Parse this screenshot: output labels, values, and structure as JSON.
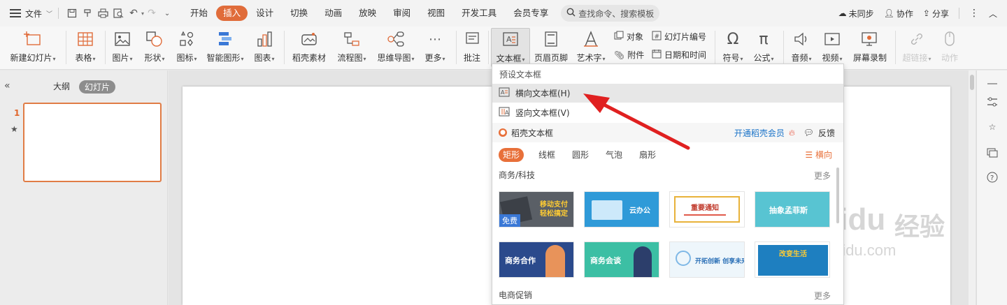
{
  "menubar": {
    "file_label": "文件",
    "tabs": [
      "开始",
      "插入",
      "设计",
      "切换",
      "动画",
      "放映",
      "审阅",
      "视图",
      "开发工具",
      "会员专享"
    ],
    "active_tab": "插入",
    "search_placeholder": "查找命令、搜索模板",
    "right": {
      "sync": "未同步",
      "collab": "协作",
      "share": "分享"
    }
  },
  "ribbon": {
    "items": [
      {
        "label": "新建幻灯片",
        "icon": "new-slide-icon",
        "dropdown": true
      },
      {
        "label": "表格",
        "icon": "table-icon",
        "dropdown": true
      },
      {
        "label": "图片",
        "icon": "picture-icon",
        "dropdown": true
      },
      {
        "label": "形状",
        "icon": "shape-icon",
        "dropdown": true
      },
      {
        "label": "图标",
        "icon": "icon-library-icon",
        "dropdown": true
      },
      {
        "label": "智能图形",
        "icon": "smartart-icon",
        "dropdown": true
      },
      {
        "label": "图表",
        "icon": "chart-icon",
        "dropdown": true
      },
      {
        "label": "稻壳素材",
        "icon": "material-icon",
        "dropdown": false
      },
      {
        "label": "流程图",
        "icon": "flowchart-icon",
        "dropdown": true
      },
      {
        "label": "思维导图",
        "icon": "mindmap-icon",
        "dropdown": true
      },
      {
        "label": "更多",
        "icon": "more-icon",
        "dropdown": true
      },
      {
        "label": "批注",
        "icon": "comment-icon",
        "dropdown": false
      },
      {
        "label": "文本框",
        "icon": "textbox-icon",
        "dropdown": true
      },
      {
        "label": "页眉页脚",
        "icon": "header-footer-icon",
        "dropdown": false
      },
      {
        "label": "艺术字",
        "icon": "wordart-icon",
        "dropdown": true
      },
      {
        "label": "符号",
        "icon": "symbol-icon",
        "dropdown": true
      },
      {
        "label": "公式",
        "icon": "formula-icon",
        "dropdown": true
      },
      {
        "label": "音频",
        "icon": "audio-icon",
        "dropdown": true
      },
      {
        "label": "视频",
        "icon": "video-icon",
        "dropdown": true
      },
      {
        "label": "屏幕录制",
        "icon": "screen-record-icon",
        "dropdown": false
      },
      {
        "label": "超链接",
        "icon": "hyperlink-icon",
        "dropdown": true
      },
      {
        "label": "动作",
        "icon": "action-icon",
        "dropdown": false
      }
    ],
    "small": {
      "object": "对象",
      "slide_number": "幻灯片编号",
      "attachment": "附件",
      "datetime": "日期和时间"
    }
  },
  "leftpanel": {
    "tab_outline": "大纲",
    "tab_slides": "幻灯片",
    "slide_number": "1"
  },
  "dropdown": {
    "preset_header": "预设文本框",
    "horizontal": "横向文本框(H)",
    "vertical": "竖向文本框(V)",
    "section_title": "稻壳文本框",
    "vip_link": "开通稻壳会员",
    "feedback": "反馈",
    "pills": [
      "矩形",
      "线框",
      "圆形",
      "气泡",
      "扇形"
    ],
    "active_pill": "矩形",
    "orientation": "横向",
    "cat1": "商务/科技",
    "cat2": "电商促销",
    "more": "更多",
    "free_badge": "免费",
    "templates": [
      {
        "title": "移动支付 轻松搞定",
        "bg": "#5a5f66",
        "color": "#ffcc33"
      },
      {
        "title": "云办公",
        "bg": "#2f9ad8",
        "color": "#ffffff"
      },
      {
        "title": "重要通知",
        "bg": "#ffffff",
        "color": "#c0392b"
      },
      {
        "title": "抽象孟菲斯",
        "bg": "#58c4d2",
        "color": "#ffffff"
      },
      {
        "title": "商务合作",
        "bg": "#2b4a8c",
        "color": "#ffffff"
      },
      {
        "title": "商务会谈",
        "bg": "#3cbfa4",
        "color": "#ffffff"
      },
      {
        "title": "开拓创新 创享未来",
        "bg": "#eef6fb",
        "color": "#2a6fb6"
      },
      {
        "title": "改变生活",
        "bg": "#1e7fc0",
        "color": "#ffffff"
      }
    ]
  },
  "watermark": {
    "brand": "Baidu",
    "cn": "经验",
    "url": "jingyan.baidu.com"
  },
  "colors": {
    "accent": "#e06c3a",
    "arrow": "#e02020"
  }
}
